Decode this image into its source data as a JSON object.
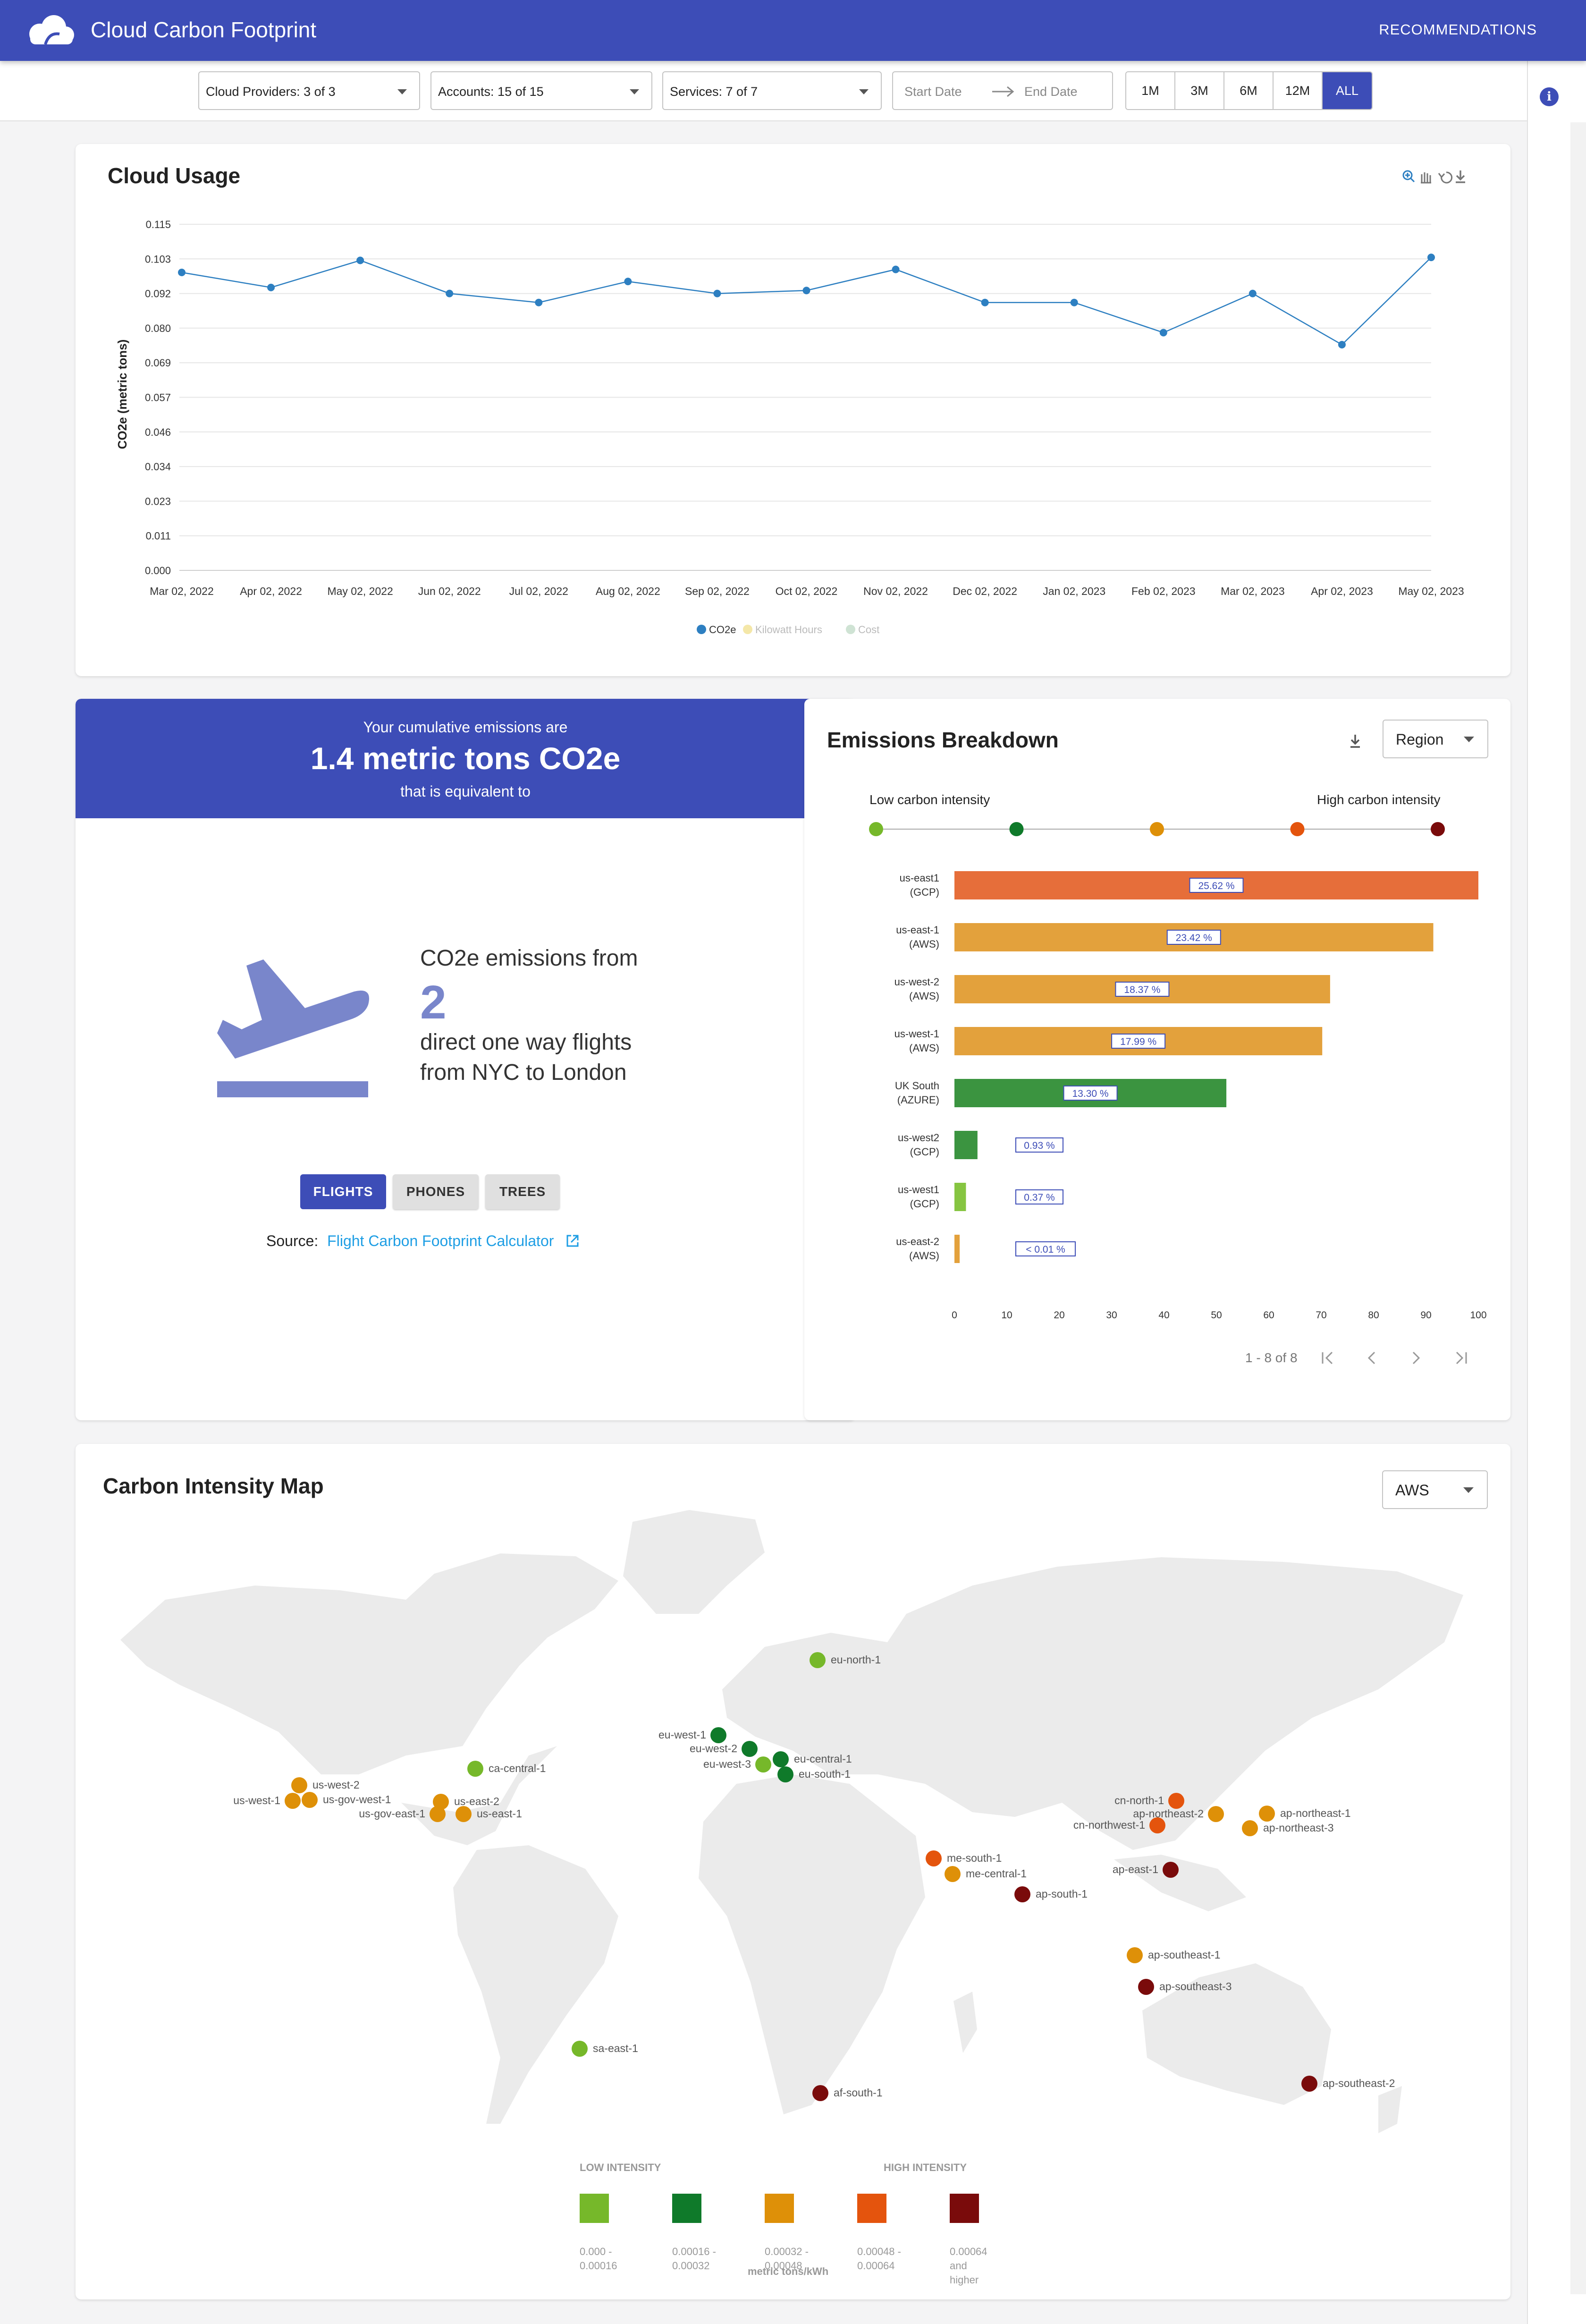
{
  "app": {
    "title": "Cloud Carbon Footprint",
    "recommendations_label": "RECOMMENDATIONS"
  },
  "filters": {
    "cloud_providers": "Cloud Providers: 3 of 3",
    "accounts": "Accounts: 15 of 15",
    "services": "Services: 7 of 7",
    "start_date": "Start Date",
    "end_date": "End Date",
    "ranges": [
      "1M",
      "3M",
      "6M",
      "12M",
      "ALL"
    ],
    "active_range": "ALL"
  },
  "cloud_usage": {
    "title": "Cloud Usage",
    "chart_data": {
      "type": "line",
      "title": "Cloud Usage",
      "ylabel": "CO2e (metric tons)",
      "xlabel": "",
      "y_ticks": [
        "0.000",
        "0.011",
        "0.023",
        "0.034",
        "0.046",
        "0.057",
        "0.069",
        "0.080",
        "0.092",
        "0.103",
        "0.115"
      ],
      "ylim": [
        0,
        0.115
      ],
      "x": [
        "Mar 02, 2022",
        "Apr 02, 2022",
        "May 02, 2022",
        "Jun 02, 2022",
        "Jul 02, 2022",
        "Aug 02, 2022",
        "Sep 02, 2022",
        "Oct 02, 2022",
        "Nov 02, 2022",
        "Dec 02, 2022",
        "Jan 02, 2023",
        "Feb 02, 2023",
        "Mar 02, 2023",
        "Apr 02, 2023",
        "May 02, 2023"
      ],
      "series": [
        {
          "name": "CO2e",
          "color": "#2d7fc1",
          "values": [
            0.099,
            0.094,
            0.103,
            0.092,
            0.089,
            0.096,
            0.092,
            0.093,
            0.1,
            0.089,
            0.089,
            0.079,
            0.092,
            0.075,
            0.104
          ]
        }
      ],
      "legend": [
        {
          "label": "CO2e",
          "color": "#2d7fc1",
          "active": true
        },
        {
          "label": "Kilowatt Hours",
          "color": "#f4e7a8",
          "active": false
        },
        {
          "label": "Cost",
          "color": "#cfe3d4",
          "active": false
        }
      ],
      "legend_position": "bottom-center",
      "grid": true
    },
    "toolbar_icons": [
      "zoom-in-icon",
      "pan-hand-icon",
      "reset-icon",
      "download-icon"
    ]
  },
  "emissions": {
    "line1": "Your cumulative emissions are",
    "line2": "1.4 metric tons CO2e",
    "line3": "that is equivalent to",
    "eq_prefix": "CO2e emissions from",
    "eq_number": "2",
    "eq_line1": "direct one way flights",
    "eq_line2": "from NYC to London",
    "tabs": [
      "FLIGHTS",
      "PHONES",
      "TREES"
    ],
    "active_tab": "FLIGHTS",
    "source_label": "Source:",
    "source_link": "Flight Carbon Footprint Calculator"
  },
  "breakdown": {
    "title": "Emissions Breakdown",
    "group_by": "Region",
    "low_label": "Low carbon intensity",
    "high_label": "High carbon intensity",
    "scale_colors": [
      "#76b82a",
      "#0f7a2a",
      "#de9008",
      "#e4540d",
      "#7a0b0b"
    ],
    "chart_data": {
      "type": "bar",
      "orientation": "horizontal",
      "categories": [
        [
          "us-east1",
          "(GCP)"
        ],
        [
          "us-east-1",
          "(AWS)"
        ],
        [
          "us-west-2",
          "(AWS)"
        ],
        [
          "us-west-1",
          "(AWS)"
        ],
        [
          "UK South",
          "(AZURE)"
        ],
        [
          "us-west2",
          "(GCP)"
        ],
        [
          "us-west1",
          "(GCP)"
        ],
        [
          "us-east-2",
          "(AWS)"
        ]
      ],
      "values": [
        100,
        91.4,
        71.7,
        70.2,
        51.9,
        4.4,
        2.2,
        1
      ],
      "labels": [
        "25.62 %",
        "23.42 %",
        "18.37 %",
        "17.99 %",
        "13.30 %",
        "0.93 %",
        "0.37 %",
        "< 0.01 %"
      ],
      "colors": [
        "#e66e3a",
        "#e3a13c",
        "#e3a13c",
        "#e3a13c",
        "#3b9440",
        "#3b9440",
        "#86c541",
        "#e3a13c"
      ],
      "x_ticks": [
        "0",
        "10",
        "20",
        "30",
        "40",
        "50",
        "60",
        "70",
        "80",
        "90",
        "100"
      ],
      "xlim": [
        0,
        100
      ]
    },
    "pagination": "1 - 8 of 8"
  },
  "map": {
    "title": "Carbon Intensity Map",
    "provider": "AWS",
    "regions": [
      {
        "name": "eu-north-1",
        "level": 0
      },
      {
        "name": "eu-west-1",
        "level": 1
      },
      {
        "name": "eu-west-2",
        "level": 1
      },
      {
        "name": "eu-west-3",
        "level": 0
      },
      {
        "name": "eu-central-1",
        "level": 1
      },
      {
        "name": "eu-south-1",
        "level": 1
      },
      {
        "name": "ca-central-1",
        "level": 0
      },
      {
        "name": "us-west-2",
        "level": 2
      },
      {
        "name": "us-west-1",
        "level": 2
      },
      {
        "name": "us-gov-west-1",
        "level": 2
      },
      {
        "name": "us-gov-east-1",
        "level": 2
      },
      {
        "name": "us-east-2",
        "level": 2
      },
      {
        "name": "us-east-1",
        "level": 2
      },
      {
        "name": "cn-north-1",
        "level": 3
      },
      {
        "name": "ap-northeast-2",
        "level": 2
      },
      {
        "name": "cn-northwest-1",
        "level": 3
      },
      {
        "name": "ap-northeast-1",
        "level": 2
      },
      {
        "name": "ap-northeast-3",
        "level": 2
      },
      {
        "name": "me-south-1",
        "level": 3
      },
      {
        "name": "me-central-1",
        "level": 2
      },
      {
        "name": "ap-south-1",
        "level": 4
      },
      {
        "name": "ap-east-1",
        "level": 4
      },
      {
        "name": "ap-southeast-1",
        "level": 2
      },
      {
        "name": "ap-southeast-3",
        "level": 4
      },
      {
        "name": "sa-east-1",
        "level": 0
      },
      {
        "name": "af-south-1",
        "level": 4
      },
      {
        "name": "ap-southeast-2",
        "level": 4
      }
    ],
    "legend": {
      "low_label": "LOW INTENSITY",
      "high_label": "HIGH INTENSITY",
      "unit": "metric tons/kWh",
      "items": [
        {
          "color": "#76b82a",
          "range": [
            "0.000 -",
            "0.00016"
          ]
        },
        {
          "color": "#0f7a2a",
          "range": [
            "0.00016 -",
            "0.00032"
          ]
        },
        {
          "color": "#de9008",
          "range": [
            "0.00032 -",
            "0.00048"
          ]
        },
        {
          "color": "#e4540d",
          "range": [
            "0.00048 -",
            "0.00064"
          ]
        },
        {
          "color": "#7a0b0b",
          "range": [
            "0.00064",
            "and",
            "higher"
          ]
        }
      ]
    }
  }
}
